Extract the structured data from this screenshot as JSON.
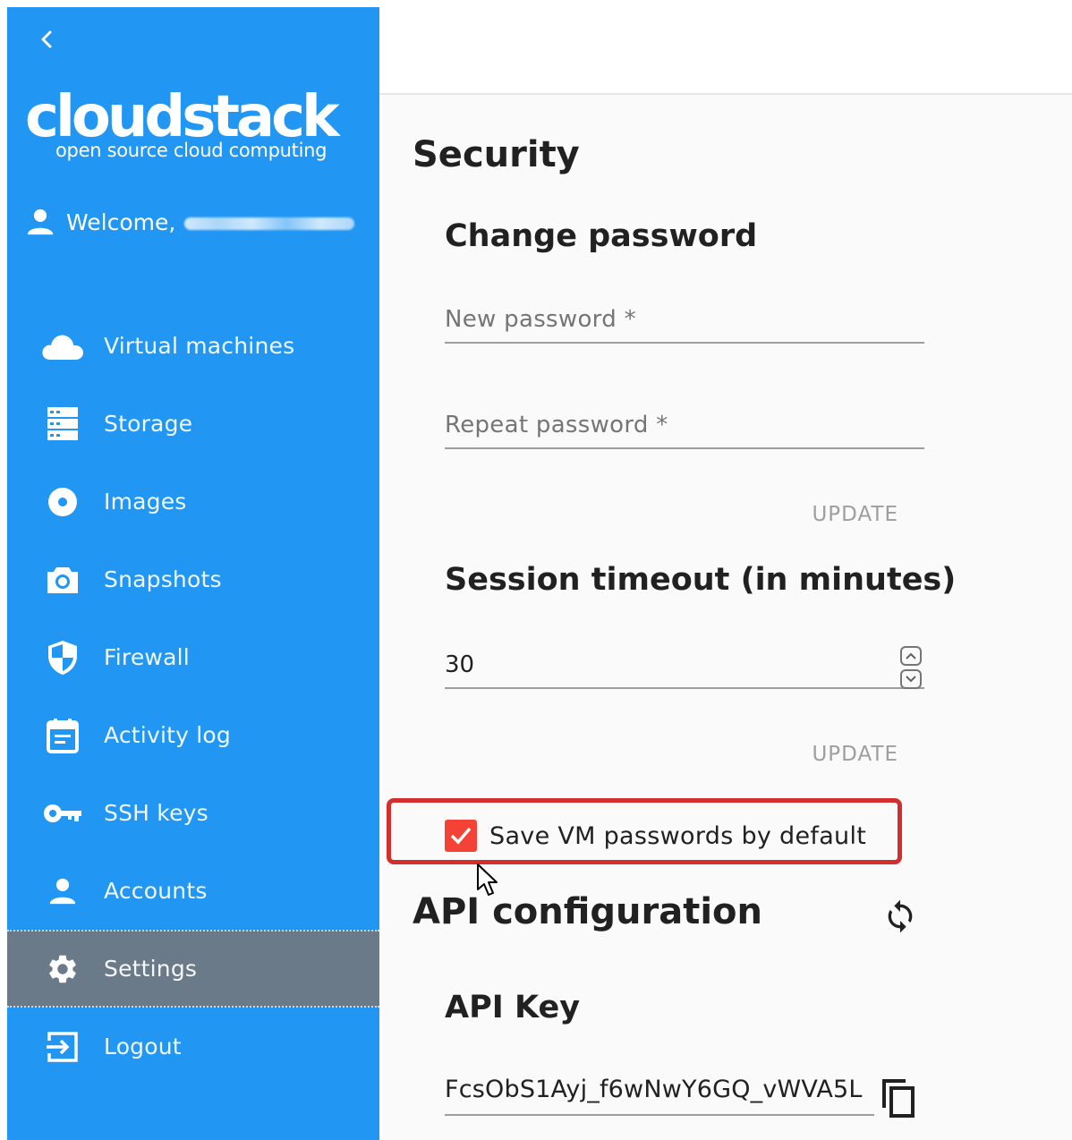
{
  "sidebar": {
    "logo": {
      "main": "cloudstack",
      "sub": "open source cloud computing"
    },
    "welcome_prefix": "Welcome,",
    "items": [
      {
        "label": "Virtual machines",
        "icon": "cloud-icon"
      },
      {
        "label": "Storage",
        "icon": "storage-icon"
      },
      {
        "label": "Images",
        "icon": "disc-icon"
      },
      {
        "label": "Snapshots",
        "icon": "camera-icon"
      },
      {
        "label": "Firewall",
        "icon": "shield-icon"
      },
      {
        "label": "Activity log",
        "icon": "calendar-icon"
      },
      {
        "label": "SSH keys",
        "icon": "key-icon"
      },
      {
        "label": "Accounts",
        "icon": "person-icon"
      },
      {
        "label": "Settings",
        "icon": "gear-icon",
        "active": true
      },
      {
        "label": "Logout",
        "icon": "logout-icon"
      }
    ]
  },
  "security": {
    "title": "Security",
    "change_password": {
      "title": "Change password",
      "new_password_placeholder": "New password *",
      "repeat_password_placeholder": "Repeat password *",
      "update_label": "UPDATE"
    },
    "session_timeout": {
      "title": "Session timeout (in minutes)",
      "value": "30",
      "update_label": "UPDATE"
    },
    "save_vm_passwords": {
      "label": "Save VM passwords by default",
      "checked": true
    }
  },
  "api_configuration": {
    "title": "API configuration",
    "api_key_title": "API Key",
    "api_key_value": "FcsObS1Ayj_f6wNwY6GQ_vWVA5L"
  },
  "colors": {
    "sidebar": "#2196f3",
    "active_item": "#6a7a89",
    "checkbox": "#f44336",
    "highlight": "#d32f2f"
  }
}
